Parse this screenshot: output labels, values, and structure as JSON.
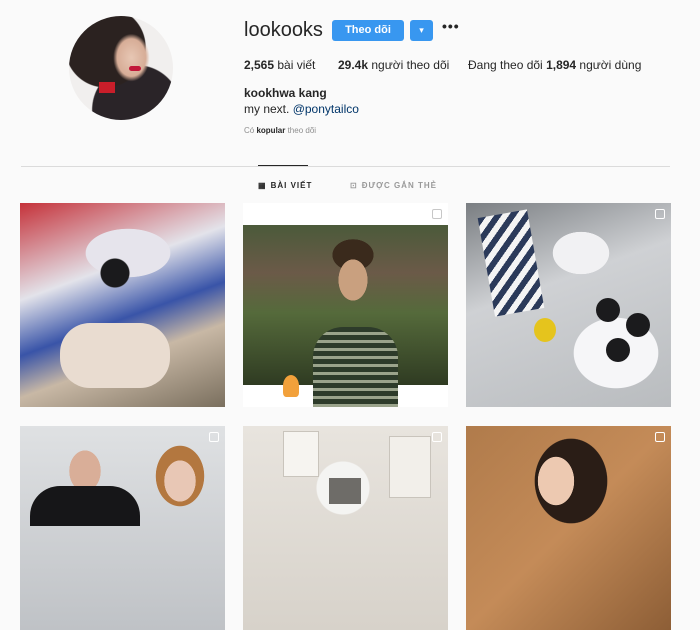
{
  "profile": {
    "username": "lookooks",
    "follow_label": "Theo dõi",
    "dropdown_icon": "▾",
    "more_icon": "•••",
    "full_name": "kookhwa kang",
    "bio_text": "my next. ",
    "bio_link": "@ponytailco",
    "followed_by_prefix": "Có ",
    "followed_by_user": "kopular",
    "followed_by_suffix": " theo dõi"
  },
  "stats": {
    "posts_count": "2,565",
    "posts_label": " bài viết",
    "followers_count": "29.4k",
    "followers_label": " người theo dõi",
    "following_prefix": "Đang theo dõi ",
    "following_count": "1,894",
    "following_label": " người dùng"
  },
  "tabs": {
    "posts": "BÀI VIẾT",
    "tagged": "ĐƯỢC GẮN THẺ",
    "posts_icon": "▦",
    "tagged_icon": "⊡"
  },
  "colors": {
    "accent": "#3897f0",
    "text": "#262626",
    "muted": "#8e8e8e",
    "link": "#003569",
    "background": "#fafafa"
  }
}
